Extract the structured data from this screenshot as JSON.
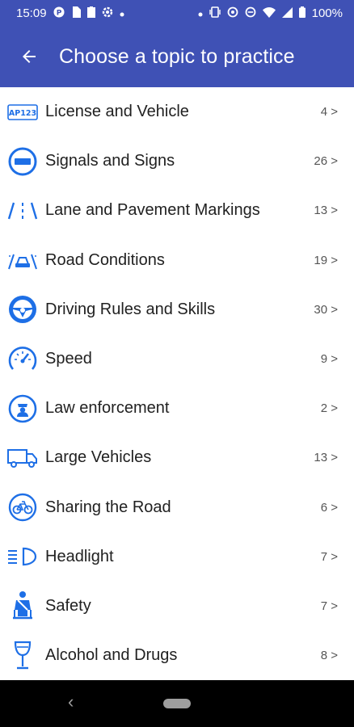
{
  "status_bar": {
    "time": "15:09",
    "battery": "100%",
    "left_icons": [
      "notification-icon",
      "storage-icon",
      "clipboard-icon",
      "settings-icon",
      "dot-icon"
    ],
    "right_icons": [
      "dot-icon",
      "vibrate-icon",
      "data-saver-icon",
      "dnd-icon",
      "wifi-icon",
      "signal-icon",
      "battery-icon"
    ]
  },
  "app_bar": {
    "title": "Choose a topic to practice",
    "back_icon": "arrow-left-icon"
  },
  "colors": {
    "primary": "#3f51b5",
    "icon_blue": "#1e6fe6",
    "text": "#212121",
    "count": "#555555"
  },
  "topics": [
    {
      "label": "License and Vehicle",
      "count": "4 >",
      "icon": "license-plate-icon",
      "plate_text": "AP123"
    },
    {
      "label": "Signals and Signs",
      "count": "26 >",
      "icon": "no-entry-sign-icon"
    },
    {
      "label": "Lane and Pavement Markings",
      "count": "13 >",
      "icon": "lane-markings-icon"
    },
    {
      "label": "Road Conditions",
      "count": "19 >",
      "icon": "car-road-conditions-icon"
    },
    {
      "label": "Driving Rules and Skills",
      "count": "30 >",
      "icon": "steering-wheel-icon"
    },
    {
      "label": "Speed",
      "count": "9 >",
      "icon": "speedometer-icon"
    },
    {
      "label": "Law enforcement",
      "count": "2 >",
      "icon": "police-badge-icon"
    },
    {
      "label": "Large Vehicles",
      "count": "13 >",
      "icon": "truck-icon"
    },
    {
      "label": "Sharing the Road",
      "count": "6 >",
      "icon": "bicycle-icon"
    },
    {
      "label": "Headlight",
      "count": "7 >",
      "icon": "headlight-icon"
    },
    {
      "label": "Safety",
      "count": "7 >",
      "icon": "seatbelt-icon"
    },
    {
      "label": "Alcohol and Drugs",
      "count": "8 >",
      "icon": "wine-glass-icon"
    }
  ],
  "nav_bar": {
    "back_glyph": "‹"
  }
}
